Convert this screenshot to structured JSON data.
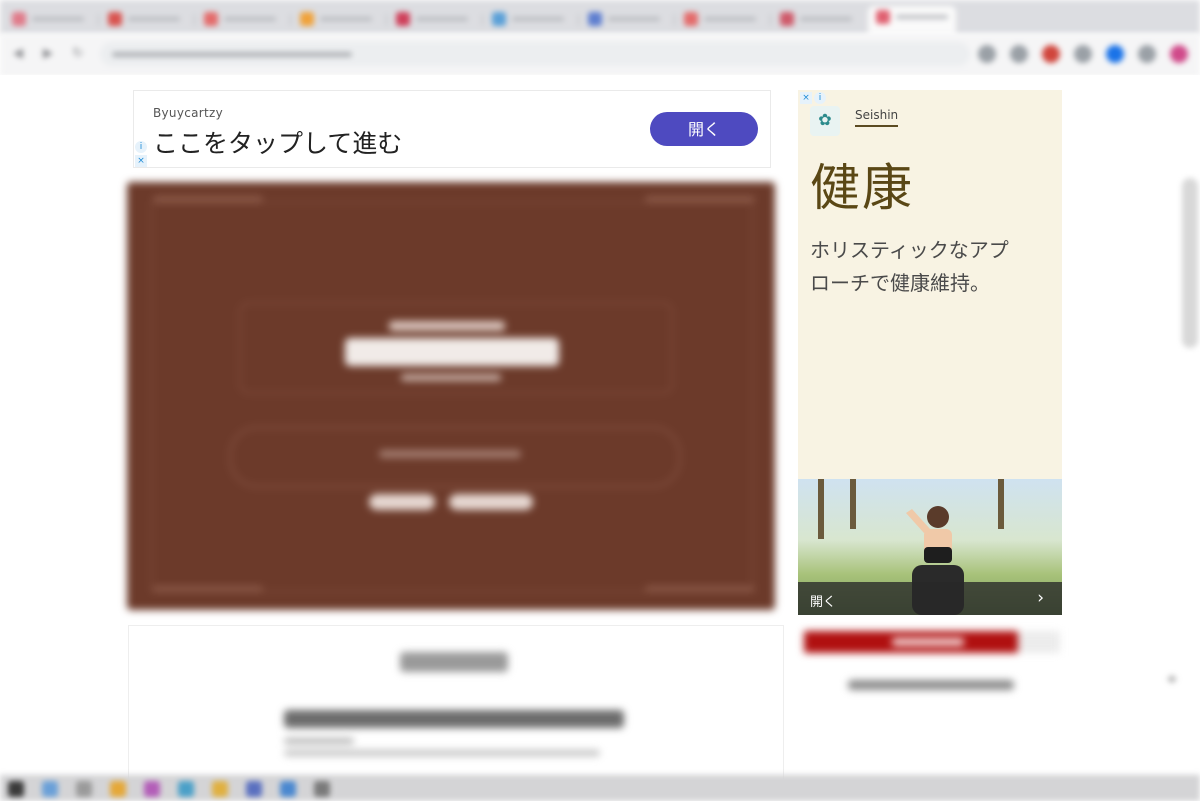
{
  "browser": {
    "tabs": [
      {
        "favicon_color": "#e07b8a"
      },
      {
        "favicon_color": "#d9534f"
      },
      {
        "favicon_color": "#e46b6b"
      },
      {
        "favicon_color": "#f0a23a"
      },
      {
        "favicon_color": "#cf3f5a"
      },
      {
        "favicon_color": "#5aa0d8"
      },
      {
        "favicon_color": "#5f7fd0"
      },
      {
        "favicon_color": "#e46b6b"
      },
      {
        "favicon_color": "#cf5a6a"
      },
      {
        "favicon_color": "#e06070",
        "active": true
      }
    ],
    "nav_icons": {
      "back": "◀",
      "forward": "▶",
      "reload": "↻"
    },
    "extension_colors": [
      "#9aa0a6",
      "#9aa0a6",
      "#d0453c",
      "#9aa0a6",
      "#1a73e8",
      "#9aa0a6",
      "#d04a8a"
    ]
  },
  "top_ad": {
    "advertiser": "Byuycartzy",
    "headline": "ここをタップして進む",
    "open_button": "開く",
    "adchoices_info": "i",
    "adchoices_close": "×",
    "button_color": "#4e4ac0"
  },
  "side_ad": {
    "adchoices_close": "×",
    "adchoices_info": "i",
    "logo_glyph": "✿",
    "brand": "Seishin",
    "heading": "健康",
    "description": "ホリスティックなアプローチで健康維持。",
    "open_label": "開く",
    "chevron": "›",
    "heading_color": "#5a4715",
    "background": "#f8f3e3"
  },
  "fab_icon": "⌖",
  "taskbar": {
    "icon_colors": [
      "#3a3a3a",
      "#6aa0d8",
      "#9a9a9a",
      "#e5a838",
      "#b35db8",
      "#4aa0c8",
      "#e0b040",
      "#5a70c0",
      "#4a88d0",
      "#7a7a7a"
    ]
  }
}
